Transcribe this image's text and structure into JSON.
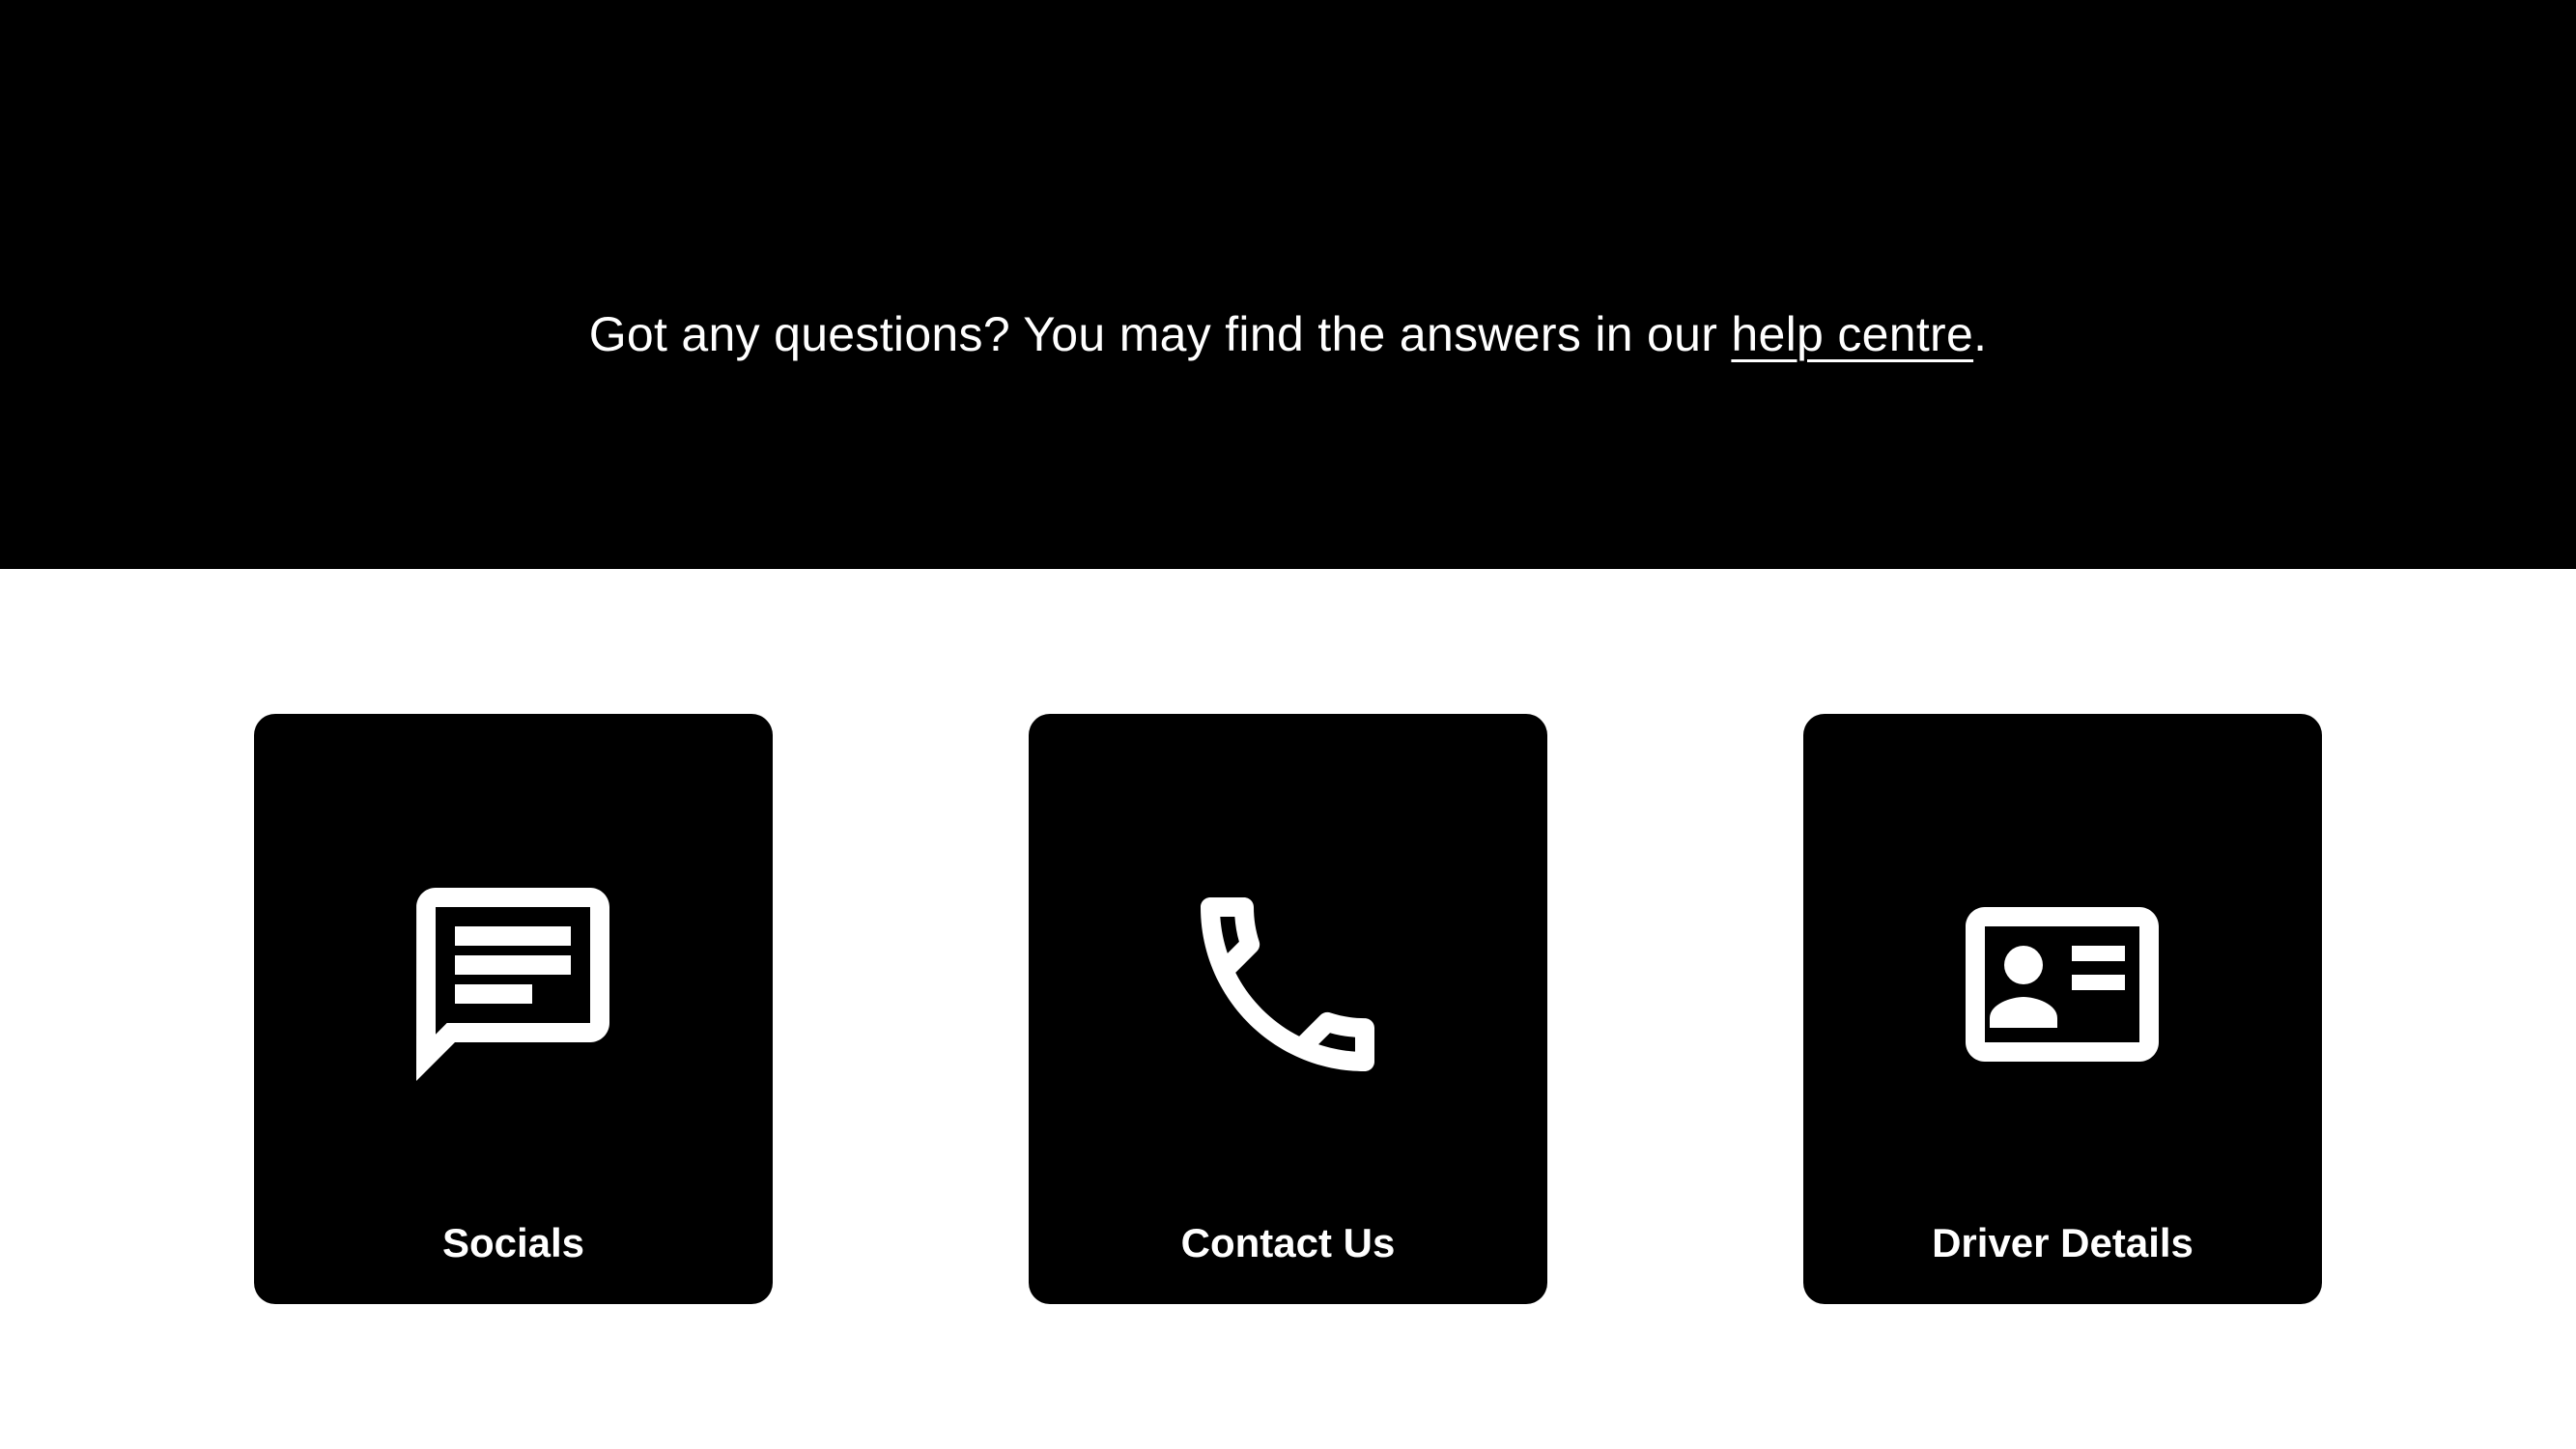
{
  "hero": {
    "text_before_link": "Got any questions? You may find the answers in our ",
    "link_label": "help centre",
    "text_after_link": "."
  },
  "cards": [
    {
      "label": "Socials",
      "icon": "chat-message-icon"
    },
    {
      "label": "Contact Us",
      "icon": "phone-icon"
    },
    {
      "label": "Driver Details",
      "icon": "id-card-icon"
    }
  ],
  "colors": {
    "background": "#ffffff",
    "hero_background": "#000000",
    "card_background": "#000000",
    "text_on_dark": "#ffffff"
  }
}
